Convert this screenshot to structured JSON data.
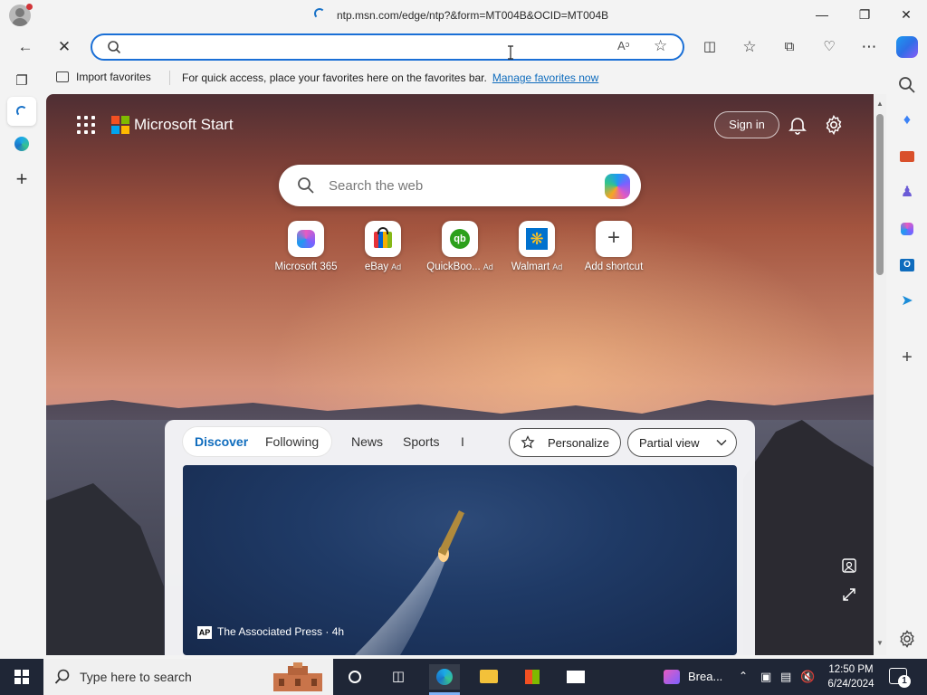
{
  "browser": {
    "tab_url_title": "ntp.msn.com/edge/ntp?&form=MT004B&OCID=MT004B",
    "address_value": "",
    "address_placeholder": ""
  },
  "favorites_bar": {
    "import_label": "Import favorites",
    "message": "For quick access, place your favorites here on the favorites bar.",
    "manage_link": "Manage favorites now"
  },
  "msstart": {
    "brand": "Microsoft Start",
    "sign_in": "Sign in",
    "search_placeholder": "Search the web",
    "shortcuts": [
      {
        "label": "Microsoft 365",
        "ad": ""
      },
      {
        "label": "eBay",
        "ad": "Ad"
      },
      {
        "label": "QuickBoo...",
        "ad": "Ad"
      },
      {
        "label": "Walmart",
        "ad": "Ad"
      },
      {
        "label": "Add shortcut",
        "ad": ""
      }
    ]
  },
  "feed": {
    "tabs": [
      "Discover",
      "Following",
      "News",
      "Sports",
      "I"
    ],
    "personalize": "Personalize",
    "view_mode": "Partial view",
    "hero": {
      "source_badge": "AP",
      "source": "The Associated Press · 4h"
    }
  },
  "taskbar": {
    "search_text": "Type here to search",
    "app_label": "Brea...",
    "time": "12:50 PM",
    "date": "6/24/2024",
    "notifications": "1"
  },
  "colors": {
    "accent": "#1a6fd6",
    "link": "#0f6cbd",
    "taskbar": "#1f2636"
  }
}
